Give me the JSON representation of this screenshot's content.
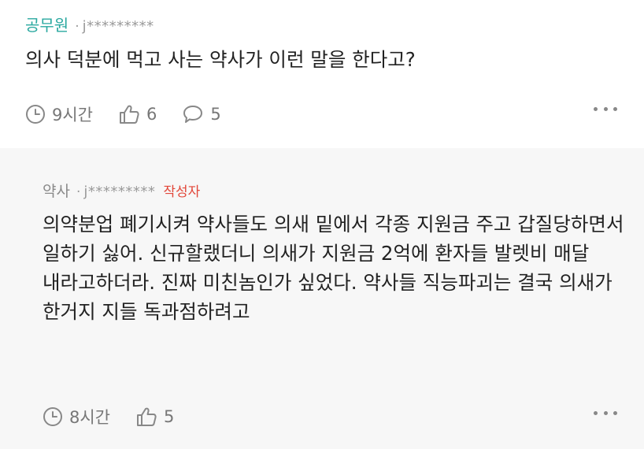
{
  "comments": [
    {
      "author": "공무원",
      "separator": "·",
      "user_id": "j*********",
      "text": "의사 덕분에 먹고 사는 약사가 이런 말을 한다고?",
      "time": "9시간",
      "likes": "6",
      "replies": "5",
      "icons": {
        "time": "clock-icon",
        "like": "thumbs-up-icon",
        "reply": "speech-bubble-icon",
        "more": "more-icon"
      }
    },
    {
      "author": "약사",
      "separator": "·",
      "user_id": "j*********",
      "badge": "작성자",
      "text": "의약분업 폐기시켜 약사들도 의새 밑에서 각종 지원금 주고 갑질당하면서 일하기 싫어. 신규할랬더니 의새가 지원금 2억에 환자들 발렛비 매달 내라고하더라. 진짜 미친놈인가 싶었다. 약사들 직능파괴는 결국 의새가 한거지 지들 독과점하려고",
      "time": "8시간",
      "likes": "5",
      "icons": {
        "time": "clock-icon",
        "like": "thumbs-up-icon",
        "more": "more-icon"
      }
    }
  ],
  "colors": {
    "author_top": "#2aa8a0",
    "badge": "#e2473a",
    "reply_bg": "#f7f7f7"
  }
}
